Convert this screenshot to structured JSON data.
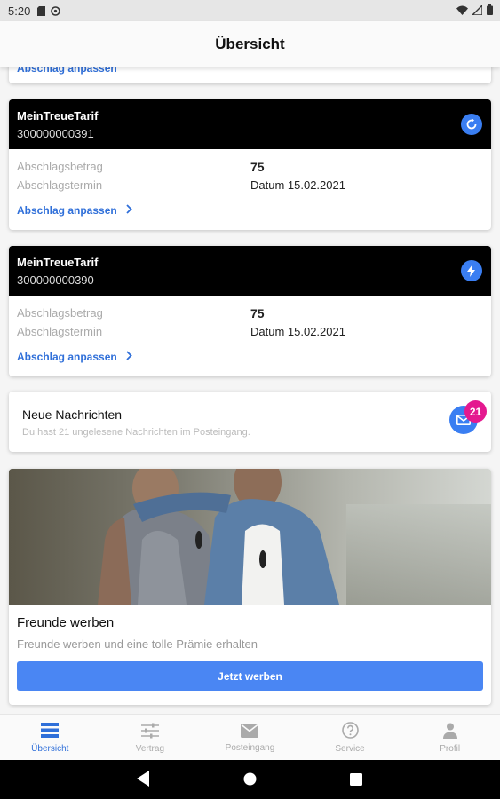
{
  "status_bar": {
    "time": "5:20"
  },
  "app_bar": {
    "title": "Übersicht"
  },
  "top_card": {
    "adjust_label": "Abschlag anpassen"
  },
  "tariffs": [
    {
      "name": "MeinTreueTarif",
      "number": "300000000391",
      "badge_icon": "refresh-icon",
      "amount_label": "Abschlagsbetrag",
      "amount_value": "75",
      "date_label": "Abschlagstermin",
      "date_value": "Datum 15.02.2021",
      "adjust_label": "Abschlag anpassen"
    },
    {
      "name": "MeinTreueTarif",
      "number": "300000000390",
      "badge_icon": "lightning-icon",
      "amount_label": "Abschlagsbetrag",
      "amount_value": "75",
      "date_label": "Abschlagstermin",
      "date_value": "Datum 15.02.2021",
      "adjust_label": "Abschlag anpassen"
    }
  ],
  "messages": {
    "title": "Neue Nachrichten",
    "subtitle": "Du hast 21 ungelesene Nachrichten im Posteingang.",
    "count": "21"
  },
  "promo": {
    "title": "Freunde werben",
    "subtitle": "Freunde werben und eine tolle Prämie erhalten",
    "button_label": "Jetzt werben"
  },
  "bottom_nav": [
    {
      "label": "Übersicht",
      "icon": "overview-icon",
      "active": true
    },
    {
      "label": "Vertrag",
      "icon": "sliders-icon",
      "active": false
    },
    {
      "label": "Posteingang",
      "icon": "mail-icon",
      "active": false
    },
    {
      "label": "Service",
      "icon": "help-icon",
      "active": false
    },
    {
      "label": "Profil",
      "icon": "person-icon",
      "active": false
    }
  ],
  "colors": {
    "accent": "#3a7ef2",
    "link": "#2f6fd9",
    "badge": "#e4198f",
    "header": "#000000"
  }
}
